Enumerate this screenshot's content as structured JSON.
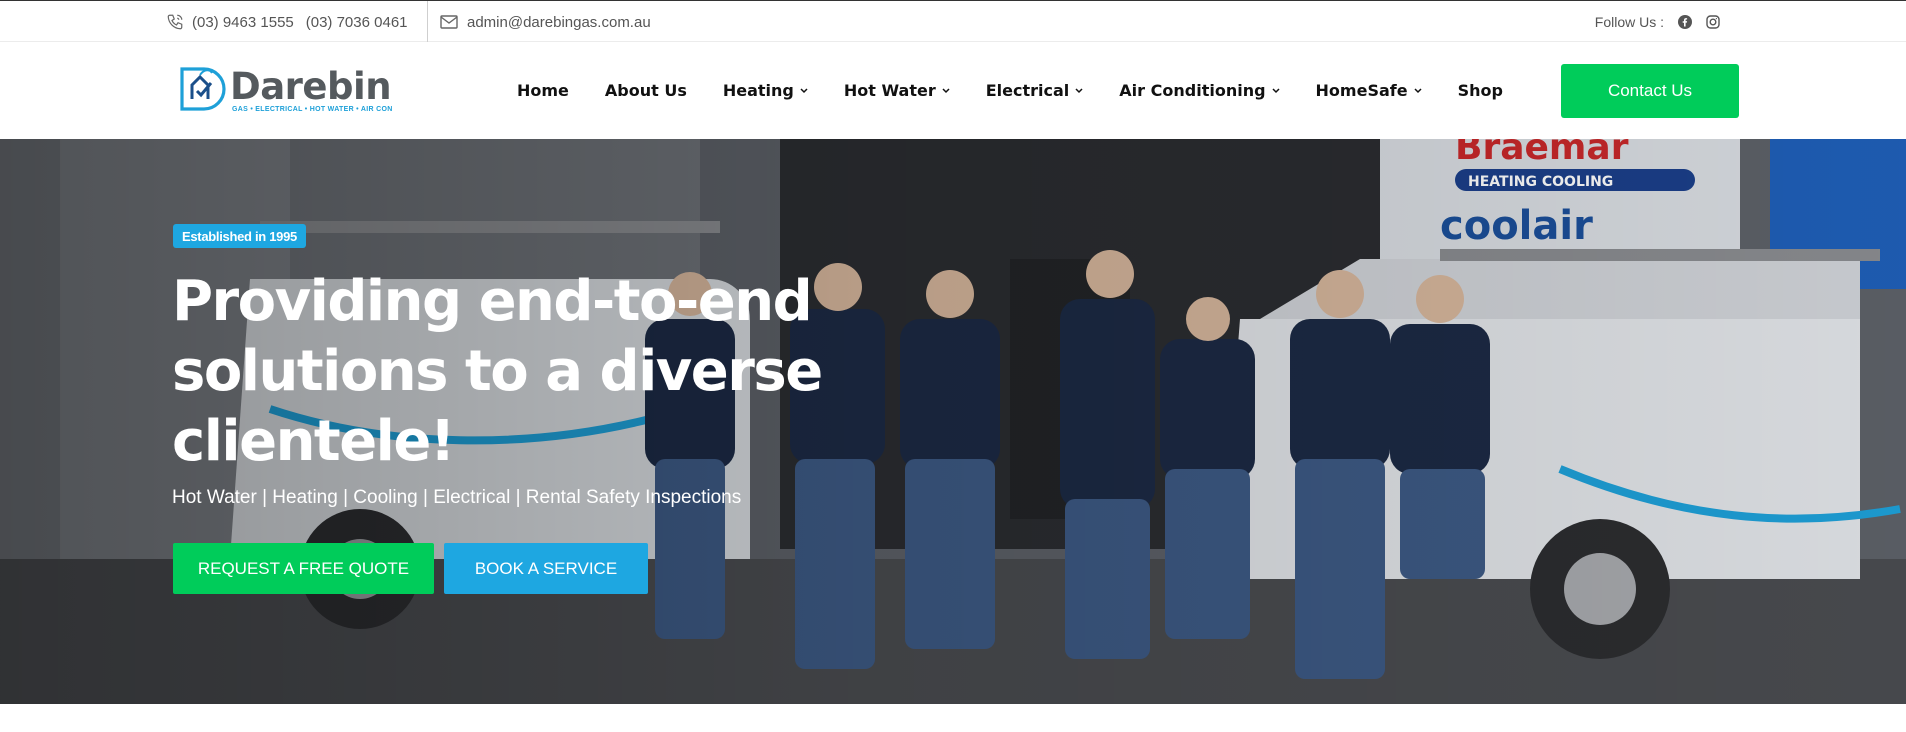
{
  "topbar": {
    "phone_1": "(03) 9463 1555",
    "phone_2": "(03) 7036 0461",
    "email": "admin@darebingas.com.au",
    "follow_label": "Follow Us :",
    "phone_icon": "phone-icon",
    "mail_icon": "mail-icon",
    "social": [
      "facebook-icon",
      "instagram-icon"
    ]
  },
  "header": {
    "logo_name": "Darebin",
    "logo_tagline": "GAS • ELECTRICAL • HOT WATER • AIR CON",
    "nav": [
      {
        "label": "Home",
        "dropdown": false
      },
      {
        "label": "About Us",
        "dropdown": false
      },
      {
        "label": "Heating",
        "dropdown": true
      },
      {
        "label": "Hot Water",
        "dropdown": true
      },
      {
        "label": "Electrical",
        "dropdown": true
      },
      {
        "label": "Air Conditioning",
        "dropdown": true
      },
      {
        "label": "HomeSafe",
        "dropdown": true
      },
      {
        "label": "Shop",
        "dropdown": false
      }
    ],
    "contact_label": "Contact Us"
  },
  "hero": {
    "badge": "Established in 1995",
    "title": "Providing end-to-end solutions to a diverse clientele!",
    "subtitle": "Hot Water | Heating | Cooling | Electrical | Rental Safety Inspections",
    "quote_button": "REQUEST A FREE QUOTE",
    "book_button": "BOOK A SERVICE"
  },
  "colors": {
    "green": "#00cc5a",
    "blue": "#1ea7e1",
    "logo_grey": "#555a5e"
  }
}
